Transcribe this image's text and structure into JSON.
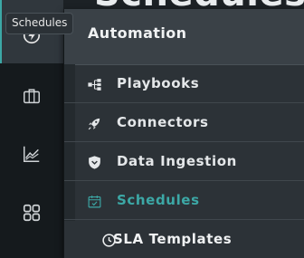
{
  "background_title": "Schedules",
  "tooltip": "Schedules",
  "rail": {
    "items": [
      {
        "icon": "lightning-icon"
      },
      {
        "icon": "briefcase-icon"
      },
      {
        "icon": "chart-line-icon"
      },
      {
        "icon": "grid-icon"
      }
    ]
  },
  "menu": {
    "header": "Automation",
    "items": [
      {
        "label": "Playbooks",
        "icon": "playbook-icon"
      },
      {
        "label": "Connectors",
        "icon": "rocket-icon"
      },
      {
        "label": "Data Ingestion",
        "icon": "shield-icon"
      },
      {
        "label": "Schedules",
        "icon": "calendar-check-icon",
        "active": true
      }
    ],
    "footer_item": {
      "label": "SLA Templates",
      "icon": "clock-icon"
    }
  },
  "colors": {
    "accent": "#3ca8a6",
    "rail_bg": "#151a1d",
    "menu_bg": "#2c3237",
    "header_bg": "#3a4147"
  }
}
